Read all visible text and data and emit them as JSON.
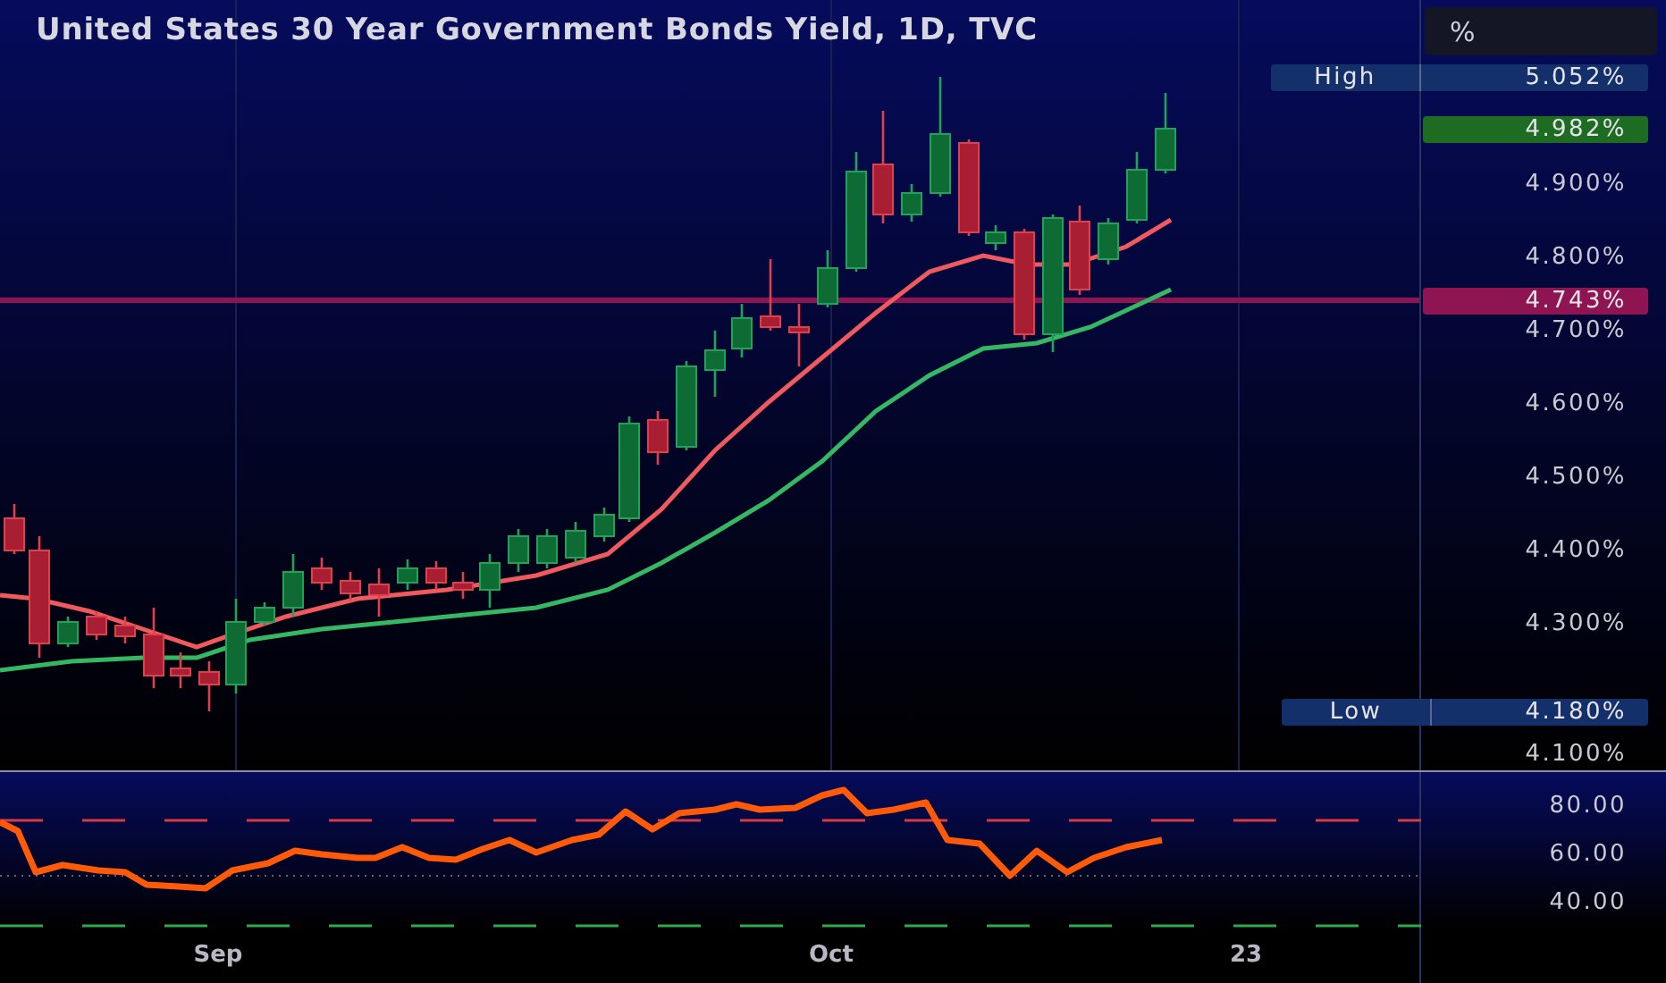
{
  "title": "United States 30 Year Government Bonds Yield, 1D, TVC",
  "unit_button": "%",
  "price_axis": [
    "4.900%",
    "4.800%",
    "4.700%",
    "4.600%",
    "4.500%",
    "4.400%",
    "4.300%",
    "4.100%"
  ],
  "markers": [
    {
      "kind": "high",
      "label": "High",
      "value": "5.052%"
    },
    {
      "kind": "last",
      "value": "4.982%",
      "color": "#1e6b22"
    },
    {
      "kind": "level",
      "value": "4.743%",
      "color": "#8e1552"
    },
    {
      "kind": "low",
      "label": "Low",
      "value": "4.180%"
    }
  ],
  "oscillator_axis": [
    "80.00",
    "60.00",
    "40.00"
  ],
  "time_axis": [
    "Sep",
    "Oct",
    "23"
  ]
}
